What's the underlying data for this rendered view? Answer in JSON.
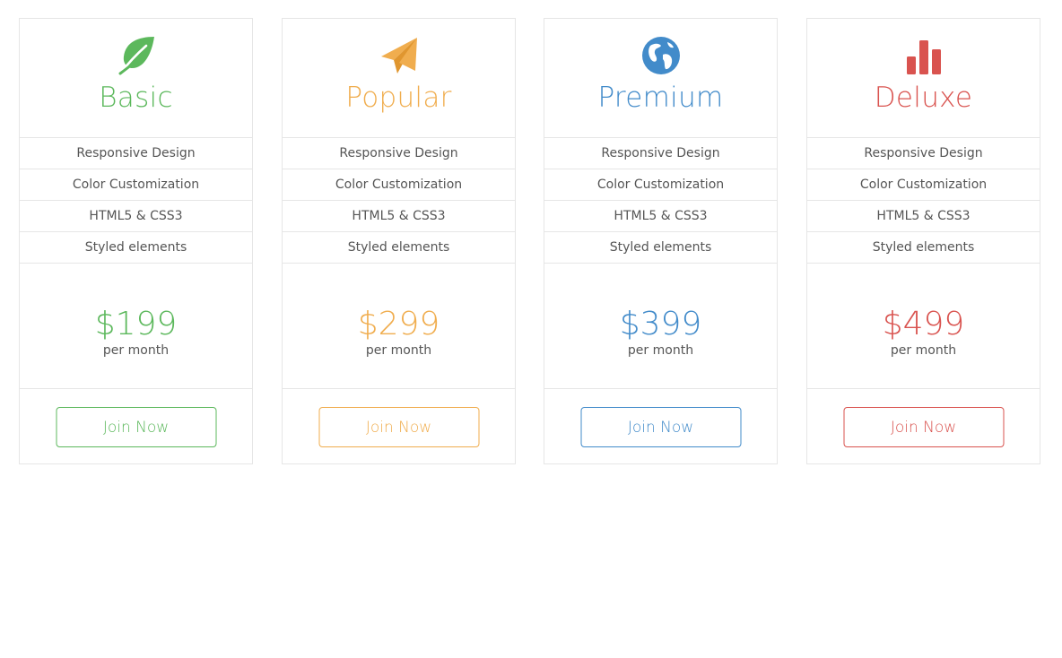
{
  "colors": {
    "basic": "#5cb85c",
    "popular": "#f0ad4e",
    "premium": "#428bca",
    "deluxe": "#d9534f",
    "border": "#e6e6e6",
    "text": "#555555"
  },
  "plans": [
    {
      "icon": "leaf-icon",
      "name": "Basic",
      "features": [
        "Responsive Design",
        "Color Customization",
        "HTML5 & CSS3",
        "Styled elements"
      ],
      "price": "$199",
      "period": "per month",
      "cta": "Join Now"
    },
    {
      "icon": "paper-plane-icon",
      "name": "Popular",
      "features": [
        "Responsive Design",
        "Color Customization",
        "HTML5 & CSS3",
        "Styled elements"
      ],
      "price": "$299",
      "period": "per month",
      "cta": "Join Now"
    },
    {
      "icon": "globe-icon",
      "name": "Premium",
      "features": [
        "Responsive Design",
        "Color Customization",
        "HTML5 & CSS3",
        "Styled elements"
      ],
      "price": "$399",
      "period": "per month",
      "cta": "Join Now"
    },
    {
      "icon": "bar-chart-icon",
      "name": "Deluxe",
      "features": [
        "Responsive Design",
        "Color Customization",
        "HTML5 & CSS3",
        "Styled elements"
      ],
      "price": "$499",
      "period": "per month",
      "cta": "Join Now"
    }
  ]
}
